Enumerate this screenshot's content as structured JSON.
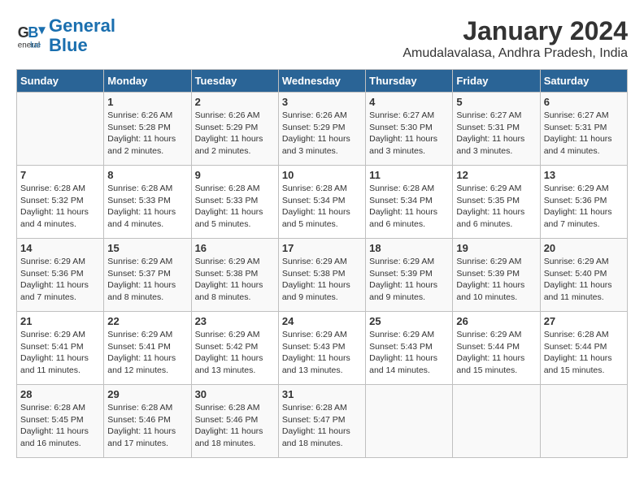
{
  "header": {
    "logo_line1": "General",
    "logo_line2": "Blue",
    "title": "January 2024",
    "subtitle": "Amudalavalasa, Andhra Pradesh, India"
  },
  "calendar": {
    "days_of_week": [
      "Sunday",
      "Monday",
      "Tuesday",
      "Wednesday",
      "Thursday",
      "Friday",
      "Saturday"
    ],
    "weeks": [
      [
        {
          "day": "",
          "info": ""
        },
        {
          "day": "1",
          "info": "Sunrise: 6:26 AM\nSunset: 5:28 PM\nDaylight: 11 hours\nand 2 minutes."
        },
        {
          "day": "2",
          "info": "Sunrise: 6:26 AM\nSunset: 5:29 PM\nDaylight: 11 hours\nand 2 minutes."
        },
        {
          "day": "3",
          "info": "Sunrise: 6:26 AM\nSunset: 5:29 PM\nDaylight: 11 hours\nand 3 minutes."
        },
        {
          "day": "4",
          "info": "Sunrise: 6:27 AM\nSunset: 5:30 PM\nDaylight: 11 hours\nand 3 minutes."
        },
        {
          "day": "5",
          "info": "Sunrise: 6:27 AM\nSunset: 5:31 PM\nDaylight: 11 hours\nand 3 minutes."
        },
        {
          "day": "6",
          "info": "Sunrise: 6:27 AM\nSunset: 5:31 PM\nDaylight: 11 hours\nand 4 minutes."
        }
      ],
      [
        {
          "day": "7",
          "info": "Sunrise: 6:28 AM\nSunset: 5:32 PM\nDaylight: 11 hours\nand 4 minutes."
        },
        {
          "day": "8",
          "info": "Sunrise: 6:28 AM\nSunset: 5:33 PM\nDaylight: 11 hours\nand 4 minutes."
        },
        {
          "day": "9",
          "info": "Sunrise: 6:28 AM\nSunset: 5:33 PM\nDaylight: 11 hours\nand 5 minutes."
        },
        {
          "day": "10",
          "info": "Sunrise: 6:28 AM\nSunset: 5:34 PM\nDaylight: 11 hours\nand 5 minutes."
        },
        {
          "day": "11",
          "info": "Sunrise: 6:28 AM\nSunset: 5:34 PM\nDaylight: 11 hours\nand 6 minutes."
        },
        {
          "day": "12",
          "info": "Sunrise: 6:29 AM\nSunset: 5:35 PM\nDaylight: 11 hours\nand 6 minutes."
        },
        {
          "day": "13",
          "info": "Sunrise: 6:29 AM\nSunset: 5:36 PM\nDaylight: 11 hours\nand 7 minutes."
        }
      ],
      [
        {
          "day": "14",
          "info": "Sunrise: 6:29 AM\nSunset: 5:36 PM\nDaylight: 11 hours\nand 7 minutes."
        },
        {
          "day": "15",
          "info": "Sunrise: 6:29 AM\nSunset: 5:37 PM\nDaylight: 11 hours\nand 8 minutes."
        },
        {
          "day": "16",
          "info": "Sunrise: 6:29 AM\nSunset: 5:38 PM\nDaylight: 11 hours\nand 8 minutes."
        },
        {
          "day": "17",
          "info": "Sunrise: 6:29 AM\nSunset: 5:38 PM\nDaylight: 11 hours\nand 9 minutes."
        },
        {
          "day": "18",
          "info": "Sunrise: 6:29 AM\nSunset: 5:39 PM\nDaylight: 11 hours\nand 9 minutes."
        },
        {
          "day": "19",
          "info": "Sunrise: 6:29 AM\nSunset: 5:39 PM\nDaylight: 11 hours\nand 10 minutes."
        },
        {
          "day": "20",
          "info": "Sunrise: 6:29 AM\nSunset: 5:40 PM\nDaylight: 11 hours\nand 11 minutes."
        }
      ],
      [
        {
          "day": "21",
          "info": "Sunrise: 6:29 AM\nSunset: 5:41 PM\nDaylight: 11 hours\nand 11 minutes."
        },
        {
          "day": "22",
          "info": "Sunrise: 6:29 AM\nSunset: 5:41 PM\nDaylight: 11 hours\nand 12 minutes."
        },
        {
          "day": "23",
          "info": "Sunrise: 6:29 AM\nSunset: 5:42 PM\nDaylight: 11 hours\nand 13 minutes."
        },
        {
          "day": "24",
          "info": "Sunrise: 6:29 AM\nSunset: 5:43 PM\nDaylight: 11 hours\nand 13 minutes."
        },
        {
          "day": "25",
          "info": "Sunrise: 6:29 AM\nSunset: 5:43 PM\nDaylight: 11 hours\nand 14 minutes."
        },
        {
          "day": "26",
          "info": "Sunrise: 6:29 AM\nSunset: 5:44 PM\nDaylight: 11 hours\nand 15 minutes."
        },
        {
          "day": "27",
          "info": "Sunrise: 6:28 AM\nSunset: 5:44 PM\nDaylight: 11 hours\nand 15 minutes."
        }
      ],
      [
        {
          "day": "28",
          "info": "Sunrise: 6:28 AM\nSunset: 5:45 PM\nDaylight: 11 hours\nand 16 minutes."
        },
        {
          "day": "29",
          "info": "Sunrise: 6:28 AM\nSunset: 5:46 PM\nDaylight: 11 hours\nand 17 minutes."
        },
        {
          "day": "30",
          "info": "Sunrise: 6:28 AM\nSunset: 5:46 PM\nDaylight: 11 hours\nand 18 minutes."
        },
        {
          "day": "31",
          "info": "Sunrise: 6:28 AM\nSunset: 5:47 PM\nDaylight: 11 hours\nand 18 minutes."
        },
        {
          "day": "",
          "info": ""
        },
        {
          "day": "",
          "info": ""
        },
        {
          "day": "",
          "info": ""
        }
      ]
    ]
  }
}
